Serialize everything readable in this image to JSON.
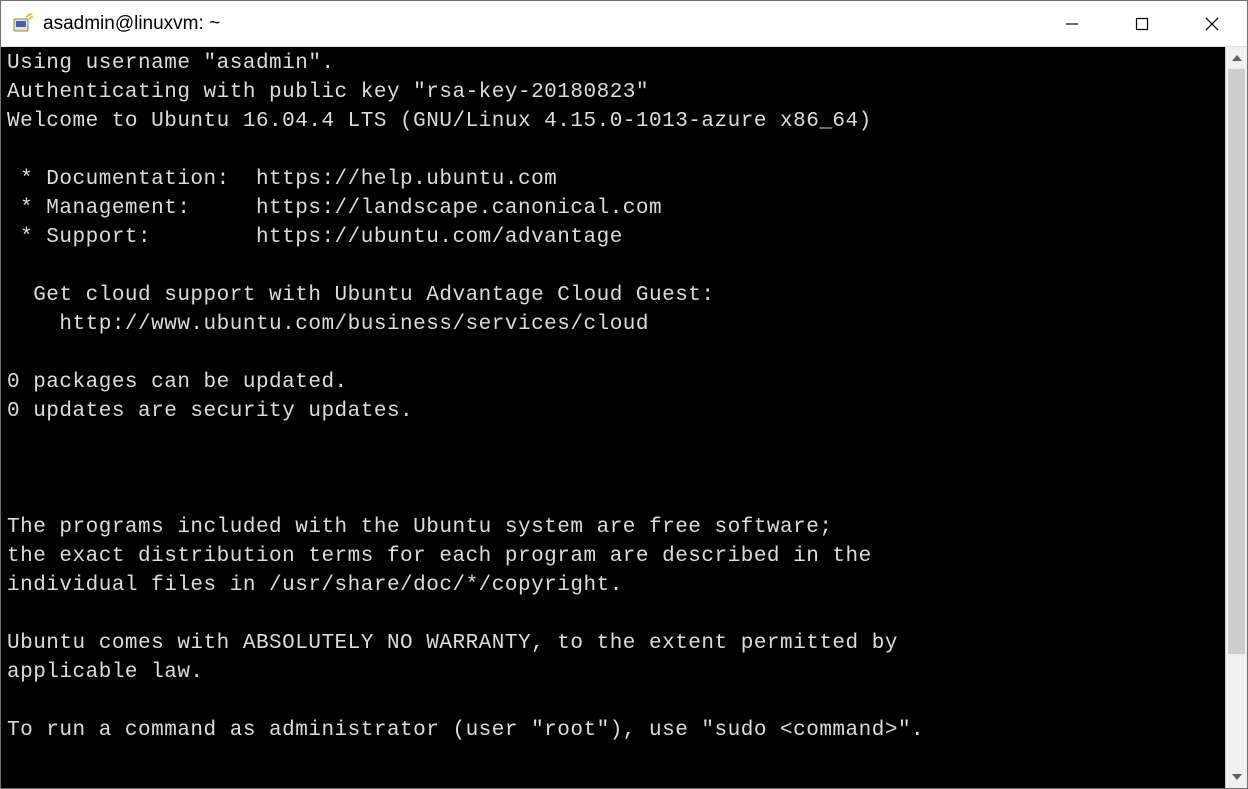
{
  "window": {
    "title": "asadmin@linuxvm: ~"
  },
  "terminal": {
    "lines": [
      "Using username \"asadmin\".",
      "Authenticating with public key \"rsa-key-20180823\"",
      "Welcome to Ubuntu 16.04.4 LTS (GNU/Linux 4.15.0-1013-azure x86_64)",
      "",
      " * Documentation:  https://help.ubuntu.com",
      " * Management:     https://landscape.canonical.com",
      " * Support:        https://ubuntu.com/advantage",
      "",
      "  Get cloud support with Ubuntu Advantage Cloud Guest:",
      "    http://www.ubuntu.com/business/services/cloud",
      "",
      "0 packages can be updated.",
      "0 updates are security updates.",
      "",
      "",
      "",
      "The programs included with the Ubuntu system are free software;",
      "the exact distribution terms for each program are described in the",
      "individual files in /usr/share/doc/*/copyright.",
      "",
      "Ubuntu comes with ABSOLUTELY NO WARRANTY, to the extent permitted by",
      "applicable law.",
      "",
      "To run a command as administrator (user \"root\"), use \"sudo <command>\"."
    ]
  }
}
